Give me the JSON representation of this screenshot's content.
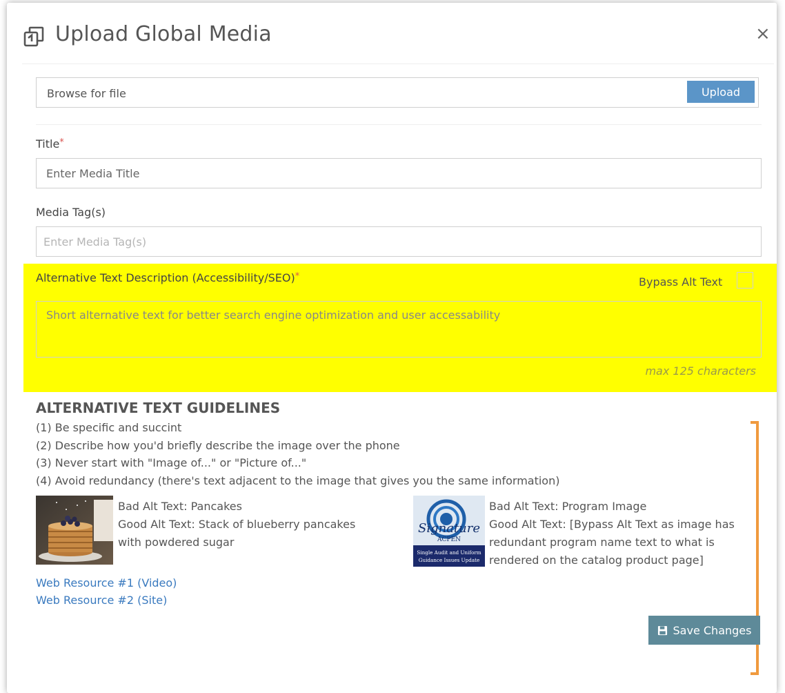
{
  "dialog": {
    "title": "Upload Global Media",
    "close_symbol": "×"
  },
  "file": {
    "label": "Browse for file",
    "upload_label": "Upload"
  },
  "title_field": {
    "label": "Title",
    "required_mark": "*",
    "placeholder": "Enter Media Title"
  },
  "tags_field": {
    "label": "Media Tag(s)",
    "placeholder": "Enter Media Tag(s)"
  },
  "alt_text": {
    "label": "Alternative Text Description (Accessibility/SEO)",
    "required_mark": "*",
    "bypass_label": "Bypass Alt Text",
    "bypass_checked": false,
    "placeholder": "Short alternative text for better search engine optimization and user accessability",
    "max_note": "max 125 characters",
    "highlight_color": "#ffff00"
  },
  "guidelines": {
    "heading": "ALTERNATIVE TEXT GUIDELINES",
    "items": [
      "(1) Be specific and succint",
      "(2) Describe how you'd briefly describe the image over the phone",
      "(3) Never start with \"Image of...\" or \"Picture of...\"",
      "(4) Avoid redundancy (there's text adjacent to the image that gives you the same information)"
    ]
  },
  "examples": [
    {
      "bad": "Bad Alt Text: Pancakes",
      "good_lines": [
        "Good Alt Text: Stack of blueberry pancakes",
        "with powdered sugar"
      ]
    },
    {
      "bad": "Bad Alt Text: Program Image",
      "good_lines": [
        "Good Alt Text: [Bypass Alt Text as image has",
        "redundant program name text to what is",
        "rendered on the catalog product page]"
      ],
      "thumb_script": "Signature",
      "thumb_sub": "ACPEN",
      "thumb_caption_1": "Single Audit and Uniform",
      "thumb_caption_2": "Guidance Issues Update"
    }
  ],
  "links": [
    "Web Resource #1 (Video)",
    "Web Resource #2 (Site)"
  ],
  "save_label": "Save Changes",
  "colors": {
    "upload_button": "#5b95c8",
    "save_button": "#5e8a99",
    "bracket": "#f09a3e",
    "link": "#3a7abf"
  }
}
